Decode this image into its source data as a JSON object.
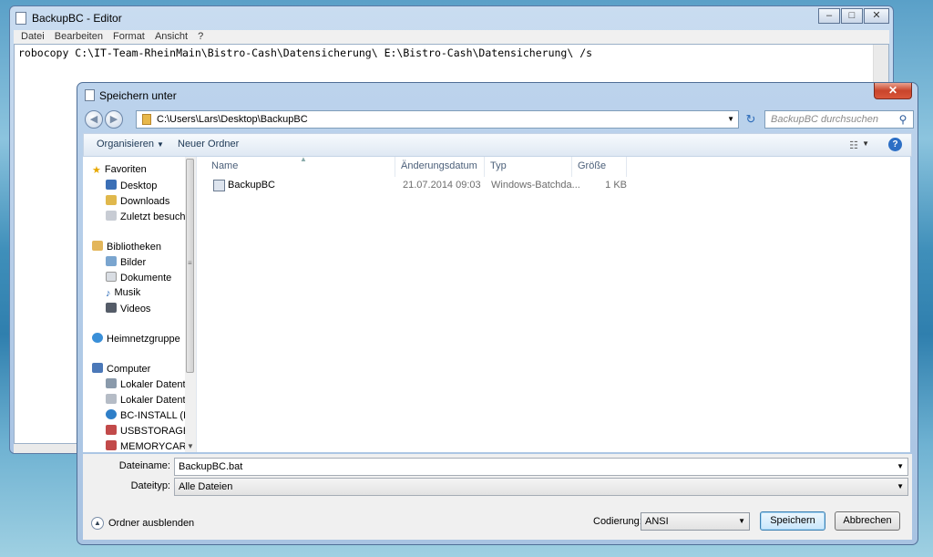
{
  "notepad": {
    "title": "BackupBC - Editor",
    "menu": [
      "Datei",
      "Bearbeiten",
      "Format",
      "Ansicht",
      "?"
    ],
    "content": "robocopy C:\\IT-Team-RheinMain\\Bistro-Cash\\Datensicherung\\ E:\\Bistro-Cash\\Datensicherung\\ /s",
    "controls": {
      "minimize": "–",
      "maximize": "□",
      "close": "✕"
    }
  },
  "dialog": {
    "title": "Speichern unter",
    "close": "✕",
    "address": "C:\\Users\\Lars\\Desktop\\BackupBC",
    "search_placeholder": "BackupBC durchsuchen",
    "toolbar": {
      "organize": "Organisieren",
      "new_folder": "Neuer Ordner"
    },
    "nav": {
      "favorites": {
        "label": "Favoriten",
        "items": [
          "Desktop",
          "Downloads",
          "Zuletzt besucht"
        ]
      },
      "libraries": {
        "label": "Bibliotheken",
        "items": [
          "Bilder",
          "Dokumente",
          "Musik",
          "Videos"
        ]
      },
      "homegroup": {
        "label": "Heimnetzgruppe"
      },
      "computer": {
        "label": "Computer",
        "items": [
          "Lokaler Datenträ",
          "Lokaler Datenträ",
          "BC-INSTALL (E:)",
          "USBSTORAGE (\\\\",
          "MEMORYCARD ("
        ]
      }
    },
    "columns": [
      "Name",
      "Änderungsdatum",
      "Typ",
      "Größe"
    ],
    "files": [
      {
        "name": "BackupBC",
        "date": "21.07.2014 09:03",
        "type": "Windows-Batchda...",
        "size": "1 KB"
      }
    ],
    "filename_label": "Dateiname:",
    "filename_value": "BackupBC.bat",
    "filetype_label": "Dateityp:",
    "filetype_value": "Alle Dateien",
    "hide_folders": "Ordner ausblenden",
    "encoding_label": "Codierung:",
    "encoding_value": "ANSI",
    "save": "Speichern",
    "cancel": "Abbrechen"
  },
  "icons": [
    "back-icon",
    "forward-icon",
    "folder-icon",
    "refresh-icon",
    "search-icon",
    "view-icon",
    "help-icon",
    "star-icon",
    "desktop-icon",
    "downloads-icon",
    "recent-icon",
    "library-icon",
    "pictures-icon",
    "documents-icon",
    "music-icon",
    "videos-icon",
    "homegroup-icon",
    "computer-icon",
    "drive-icon",
    "batch-file-icon",
    "chevron-down-icon",
    "close-icon"
  ]
}
